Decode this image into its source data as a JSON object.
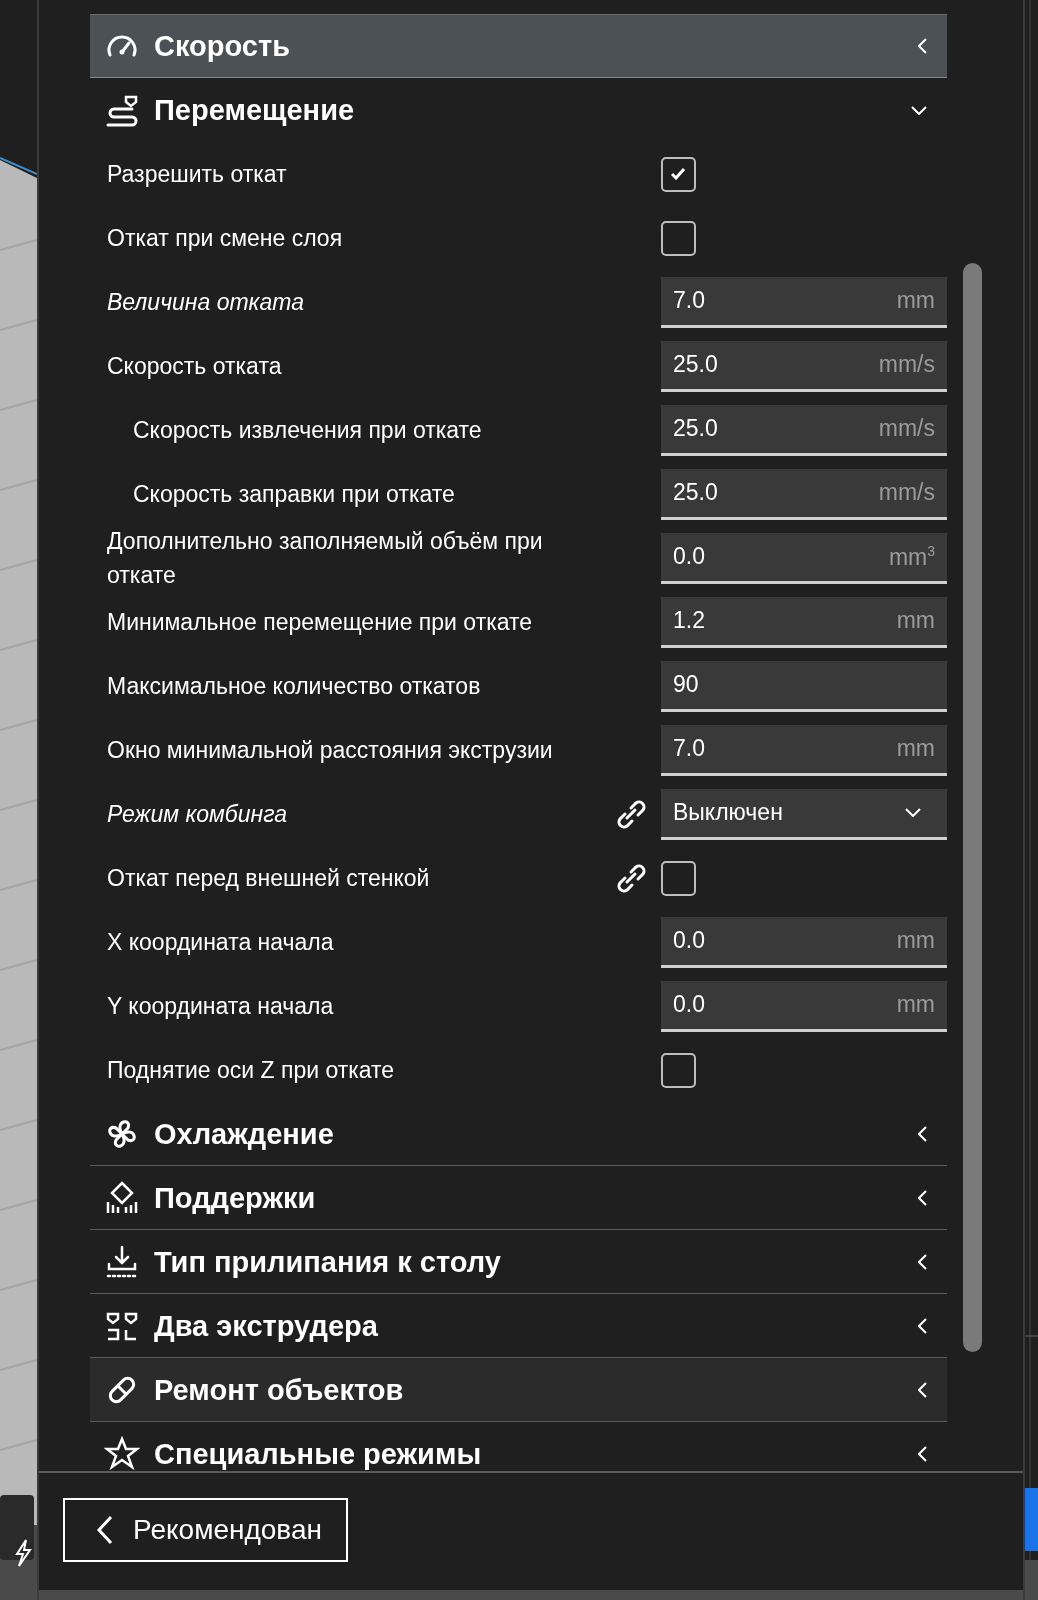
{
  "sections": [
    {
      "title": "Скорость",
      "expanded": false,
      "highlighted": true,
      "hovered": false
    },
    {
      "title": "Перемещение",
      "expanded": true,
      "highlighted": false,
      "hovered": false,
      "settings": [
        {
          "label": "Разрешить откат",
          "kind": "checkbox",
          "checked": true,
          "modified": false,
          "linked": false
        },
        {
          "label": "Откат при смене слоя",
          "kind": "checkbox",
          "checked": false,
          "modified": false,
          "linked": false
        },
        {
          "label": "Величина отката",
          "kind": "number",
          "value": "7.0",
          "unit": "mm",
          "modified": true,
          "linked": false
        },
        {
          "label": "Скорость отката",
          "kind": "number",
          "value": "25.0",
          "unit": "mm/s",
          "modified": false,
          "linked": false,
          "children": [
            {
              "label": "Скорость извлечения при откате",
              "kind": "number",
              "value": "25.0",
              "unit": "mm/s",
              "modified": false,
              "linked": false
            },
            {
              "label": "Скорость заправки при откате",
              "kind": "number",
              "value": "25.0",
              "unit": "mm/s",
              "modified": false,
              "linked": false
            }
          ]
        },
        {
          "label": "Дополнительно заполняемый объём при откате",
          "kind": "number",
          "value": "0.0",
          "unit": "mm$^{3}$",
          "modified": false,
          "linked": false
        },
        {
          "label": "Минимальное перемещение при откате",
          "kind": "number",
          "value": "1.2",
          "unit": "mm",
          "modified": false,
          "linked": false
        },
        {
          "label": "Максимальное количество откатов",
          "kind": "number",
          "value": "90",
          "modified": false,
          "linked": false
        },
        {
          "label": "Окно минимальной расстояния экструзии",
          "kind": "number",
          "value": "7.0",
          "unit": "mm",
          "modified": false,
          "linked": false
        },
        {
          "label": "Режим комбинга",
          "kind": "dropdown",
          "value": "Выключен",
          "modified": true,
          "linked": true
        },
        {
          "label": "Откат перед внешней стенкой",
          "kind": "checkbox",
          "checked": false,
          "modified": false,
          "linked": true
        },
        {
          "label": "X координата начала",
          "kind": "number",
          "value": "0.0",
          "unit": "mm",
          "modified": false,
          "linked": false
        },
        {
          "label": "Y координата начала",
          "kind": "number",
          "value": "0.0",
          "unit": "mm",
          "modified": false,
          "linked": false
        },
        {
          "label": "Поднятие оси Z при откате",
          "kind": "checkbox",
          "checked": false,
          "modified": false,
          "linked": false
        }
      ]
    },
    {
      "title": "Охлаждение",
      "expanded": false,
      "highlighted": false,
      "hovered": false
    },
    {
      "title": "Поддержки",
      "expanded": false,
      "highlighted": false,
      "hovered": false
    },
    {
      "title": "Тип прилипания к столу",
      "expanded": false,
      "highlighted": false,
      "hovered": false
    },
    {
      "title": "Два экструдера",
      "expanded": false,
      "highlighted": false,
      "hovered": false
    },
    {
      "title": "Ремонт объектов",
      "expanded": false,
      "highlighted": false,
      "hovered": true
    },
    {
      "title": "Специальные режимы",
      "expanded": false,
      "highlighted": false,
      "hovered": false
    }
  ],
  "footer": {
    "button": "Рекомендован"
  }
}
